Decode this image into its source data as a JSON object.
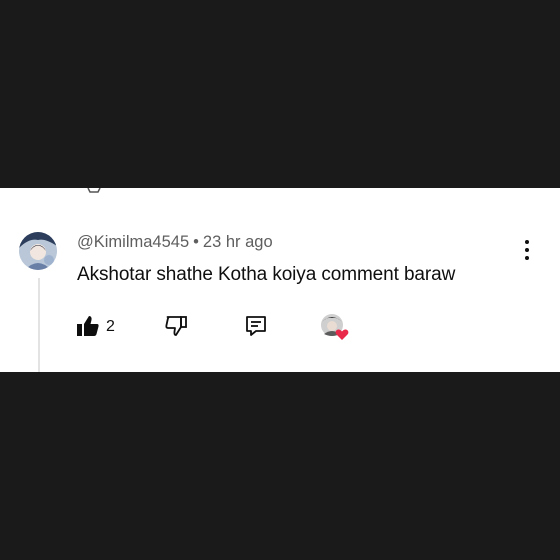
{
  "comment": {
    "author": "@Kimilma4545",
    "separator": "•",
    "time": "23 hr ago",
    "text": "Akshotar shathe Kotha koiya comment baraw"
  },
  "actions": {
    "like_count": "2"
  },
  "icons": {
    "like": "thumbs-up-icon",
    "dislike": "thumbs-down-icon",
    "reply": "reply-comment-icon",
    "more": "more-vertical-icon",
    "creator_heart": "creator-heart-badge-icon"
  },
  "colors": {
    "background": "#1a1a1a",
    "card": "#ffffff",
    "heart": "#e8294a",
    "meta_text": "#5f5f5f"
  }
}
